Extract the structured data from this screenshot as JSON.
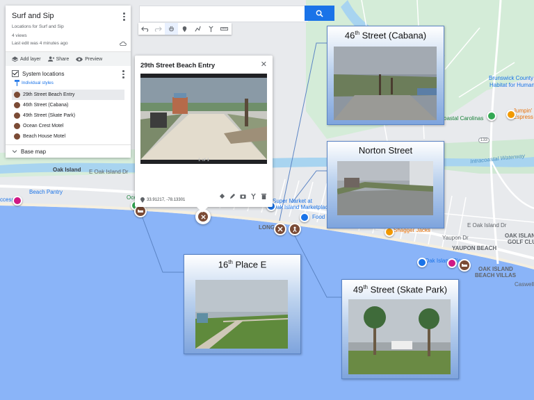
{
  "search": {
    "placeholder": ""
  },
  "panel": {
    "map_title": "Surf and Sip",
    "description": "Locations for Surf and Sip",
    "views": "4 views",
    "last_edit": "Last edit was 4 minutes ago",
    "actions": {
      "add_layer": "Add layer",
      "share": "Share",
      "preview": "Preview"
    },
    "layer": {
      "name": "System locations",
      "style_link": "Individual styles",
      "items": [
        {
          "label": "29th Street Beach Entry",
          "selected": true
        },
        {
          "label": "46th Street (Cabana)",
          "selected": false
        },
        {
          "label": "49th Street (Skate Park)",
          "selected": false
        },
        {
          "label": "Ocean Crest Motel",
          "selected": false
        },
        {
          "label": "Beach House Motel",
          "selected": false
        }
      ]
    },
    "base_map": "Base map"
  },
  "popup": {
    "title": "29th Street Beach Entry",
    "photo_counter": "1 of 1",
    "coordinates": "33.91217, -78.13301"
  },
  "cards": {
    "c46": {
      "base": "46",
      "sup": "th",
      "rest": " Street (Cabana)"
    },
    "norton": {
      "title": "Norton Street"
    },
    "c16": {
      "base": "16",
      "sup": "th",
      "rest": " Place E"
    },
    "c49": {
      "base": "49",
      "sup": "th",
      "rest": " Street (Skate Park)"
    }
  },
  "map_labels": {
    "brunswick": "Brunswick County",
    "habitat": "Habitat for Humanity...",
    "jumpin1": "Jumpin'",
    "jumpin2": "Espress",
    "coastal": "oastal Carolinas",
    "waterway": "Intracoastal Waterway",
    "oak_island": "Oak Island",
    "e_oak_island_dr": "E Oak Island Dr",
    "beach_pantry": "Beach Pantry",
    "access": "ccess",
    "super_market1": "Super Market at",
    "super_market2": "Oak Island Marketplace",
    "food": "Food",
    "long": "LONG",
    "shagger": "Shagger Jacks",
    "yaupon": "YAUPON BEACH",
    "yaupon_dr": "Yaupon Dr",
    "oak_golf1": "OAK ISLAND",
    "oak_golf2": "GOLF CLUB",
    "oak_pier": "Oak Island Pier",
    "villas1": "OAK ISLAND",
    "villas2": "BEACH VILLAS",
    "caswell": "Caswell B",
    "e_oak_dr2": "E Oak Island Dr",
    "route": "133",
    "oce": "Oce"
  },
  "colors": {
    "ocean": "#8ab4f8",
    "land": "#e8eaed",
    "pin": "#7b4b35",
    "accent": "#1a73e8"
  }
}
